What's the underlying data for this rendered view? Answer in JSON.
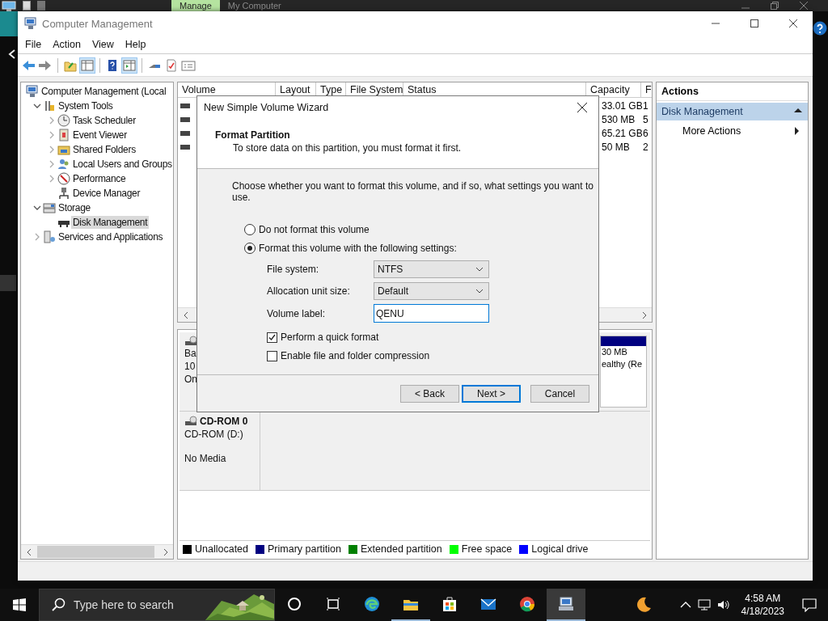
{
  "desktop": {
    "tabs": [
      {
        "label": "Manage",
        "selected": true
      },
      {
        "label": "My Computer",
        "selected": false
      }
    ]
  },
  "window": {
    "title": "Computer Management",
    "menu": [
      "File",
      "Action",
      "View",
      "Help"
    ]
  },
  "tree": {
    "items": [
      {
        "label": "Computer Management (Local",
        "selected": false,
        "children": [
          {
            "label": "System Tools",
            "expanded": true,
            "selected": false,
            "children": [
              {
                "label": "Task Scheduler",
                "expanded": false,
                "selected": false
              },
              {
                "label": "Event Viewer",
                "expanded": false,
                "selected": false
              },
              {
                "label": "Shared Folders",
                "expanded": false,
                "selected": false
              },
              {
                "label": "Local Users and Groups",
                "expanded": false,
                "selected": false
              },
              {
                "label": "Performance",
                "expanded": false,
                "selected": false
              },
              {
                "label": "Device Manager",
                "selected": false
              }
            ]
          },
          {
            "label": "Storage",
            "expanded": true,
            "selected": false,
            "children": [
              {
                "label": "Disk Management",
                "selected": true
              }
            ]
          },
          {
            "label": "Services and Applications",
            "expanded": false,
            "selected": false
          }
        ]
      }
    ]
  },
  "volumes": {
    "columns": [
      "Volume",
      "Layout",
      "Type",
      "File System",
      "Status",
      "Capacity",
      "F"
    ],
    "rows": [
      {
        "capacity": "33.01 GB",
        "column_7": "1"
      },
      {
        "capacity": "530 MB",
        "column_7": "5"
      },
      {
        "capacity": "65.21 GB",
        "column_7": "6"
      },
      {
        "capacity": "50 MB",
        "column_7": "2"
      }
    ]
  },
  "disks": [
    {
      "lines": [
        "Ba",
        "10",
        "On"
      ],
      "partition": {
        "lines": [
          "30 MB",
          "ealthy (Re"
        ],
        "color": "#000080"
      }
    },
    {
      "name": "CD-ROM 0",
      "lines": [
        "CD-ROM (D:)",
        "No Media"
      ]
    }
  ],
  "legend": [
    {
      "label": "Unallocated",
      "color": "#000000"
    },
    {
      "label": "Primary partition",
      "color": "#000080"
    },
    {
      "label": "Extended partition",
      "color": "#008000"
    },
    {
      "label": "Free space",
      "color": "#00ff00"
    },
    {
      "label": "Logical drive",
      "color": "#0000ff"
    }
  ],
  "actions": {
    "title": "Actions",
    "items": [
      {
        "label": "Disk Management",
        "kind": "section"
      },
      {
        "label": "More Actions",
        "kind": "submenu"
      }
    ]
  },
  "wizard": {
    "title": "New Simple Volume Wizard",
    "heading": "Format Partition",
    "subheading": "To store data on this partition, you must format it first.",
    "prompt": "Choose whether you want to format this volume, and if so, what settings you want to use.",
    "options": [
      {
        "label": "Do not format this volume",
        "selected": false
      },
      {
        "label": "Format this volume with the following settings:",
        "selected": true
      }
    ],
    "fields": [
      {
        "label": "File system:",
        "kind": "dropdown",
        "value": "NTFS"
      },
      {
        "label": "Allocation unit size:",
        "kind": "dropdown",
        "value": "Default"
      },
      {
        "label": "Volume label:",
        "kind": "text",
        "value": "QENU",
        "focused": true
      }
    ],
    "checkboxes": [
      {
        "label": "Perform a quick format",
        "checked": true
      },
      {
        "label": "Enable file and folder compression",
        "checked": false
      }
    ],
    "buttons": [
      {
        "label": "< Back",
        "default": false
      },
      {
        "label": "Next >",
        "default": true
      },
      {
        "label": "Cancel",
        "default": false
      }
    ]
  },
  "taskbar": {
    "search": {
      "placeholder": "Type here to search"
    },
    "apps": [
      {
        "kind": "cortana",
        "running": false,
        "active": false
      },
      {
        "kind": "taskview",
        "running": false,
        "active": false
      },
      {
        "kind": "edge",
        "running": false,
        "active": false
      },
      {
        "kind": "explorer",
        "running": true,
        "active": false
      },
      {
        "kind": "store",
        "running": false,
        "active": false
      },
      {
        "kind": "mail",
        "running": false,
        "active": false
      },
      {
        "kind": "chrome",
        "running": false,
        "active": false
      },
      {
        "kind": "computer",
        "running": true,
        "active": true
      }
    ],
    "clock": {
      "time": "4:58 AM",
      "date": "4/18/2023"
    }
  }
}
